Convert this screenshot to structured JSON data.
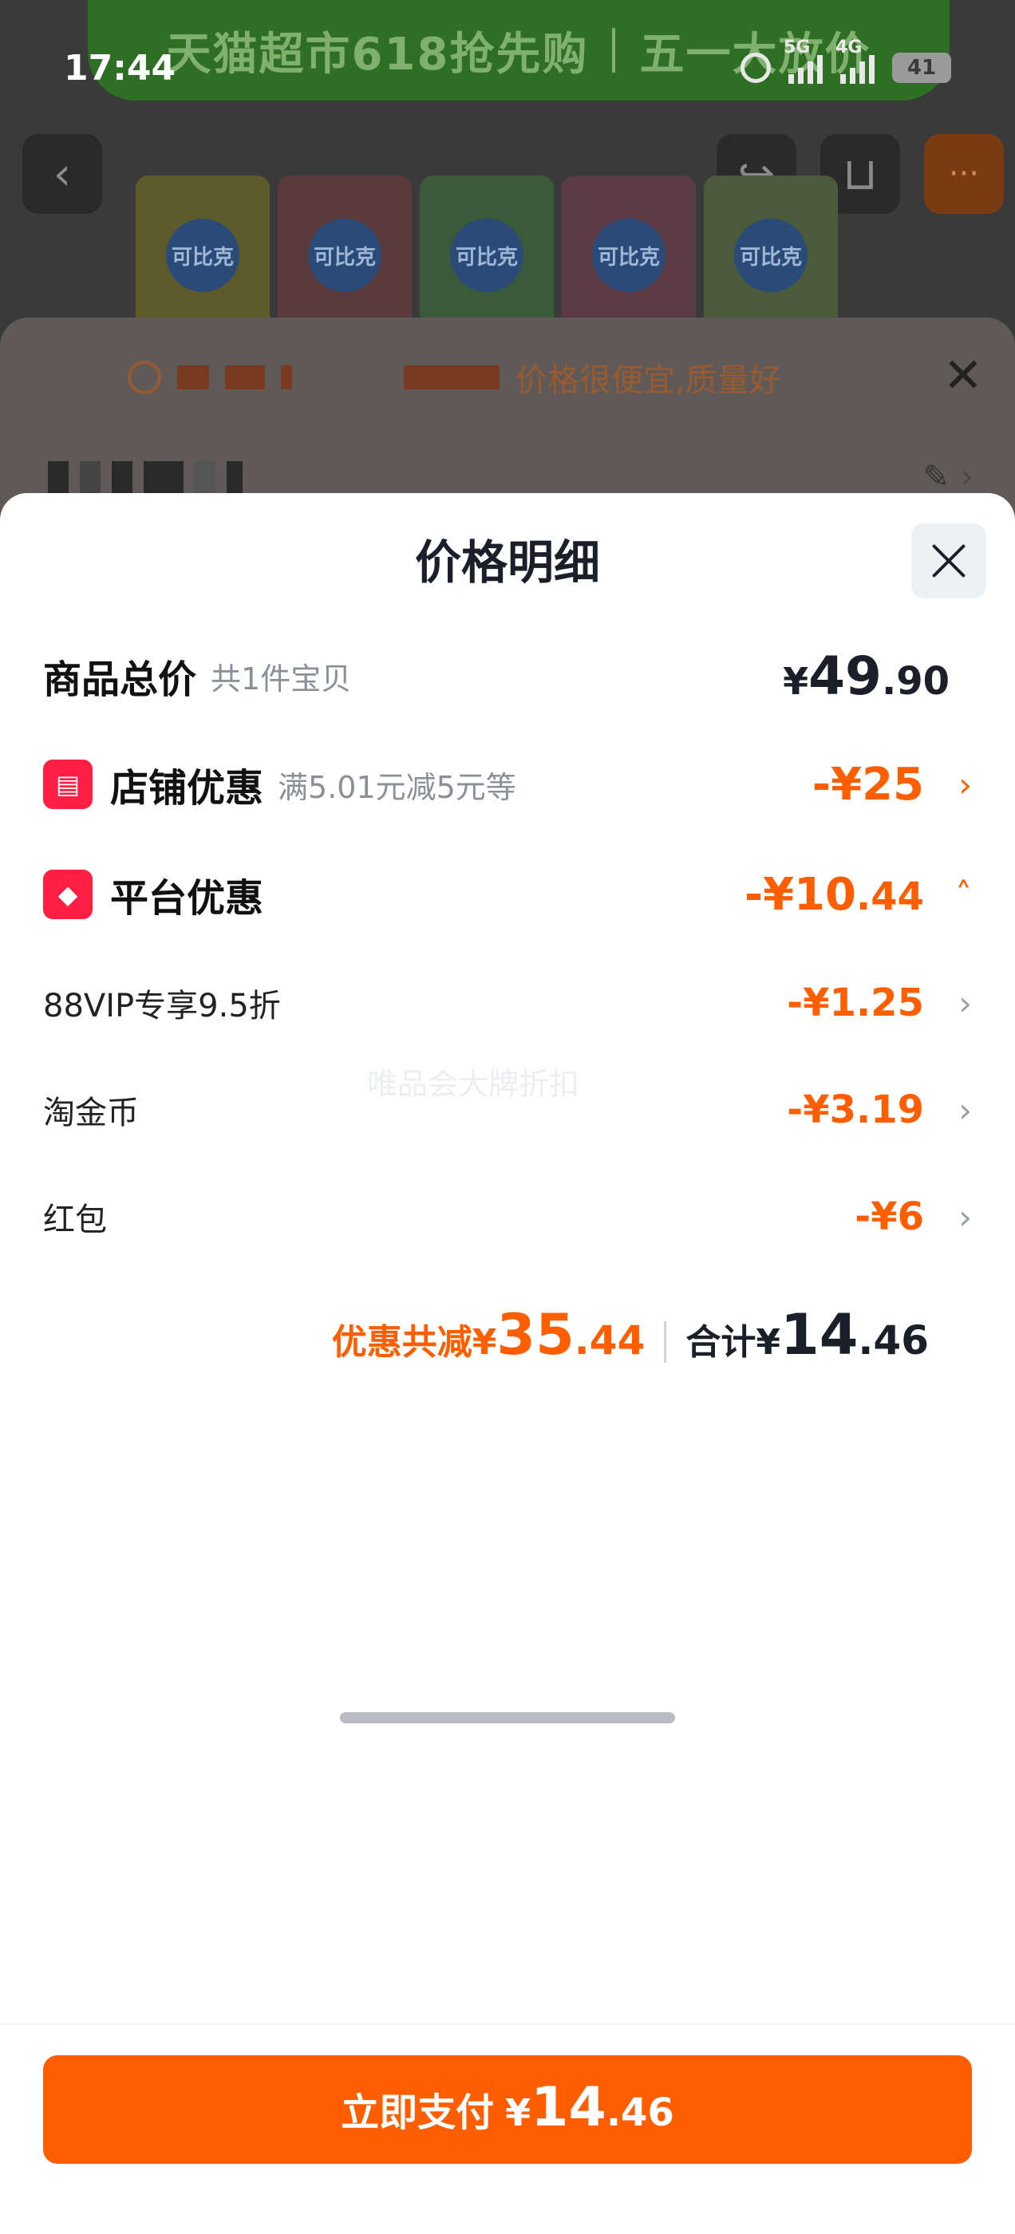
{
  "status_bar": {
    "time": "17:44",
    "net_5g": "5G",
    "net_4g": "4G",
    "battery": "41"
  },
  "promo_banner": {
    "left_text": "天猫超市618抢先购",
    "right_text": "五一大放价"
  },
  "review_banner": {
    "text": "价格很便宜,质量好"
  },
  "price_detail": {
    "title": "价格明细",
    "goods_total": {
      "label": "商品总价",
      "sub": "共1件宝贝",
      "currency": "¥",
      "int": "49",
      "dec": ".90"
    },
    "shop_discount": {
      "label": "店铺优惠",
      "sub": "满5.01元减5元等",
      "amount": "-¥25"
    },
    "platform_discount": {
      "label": "平台优惠",
      "amount_int": "-¥10",
      "amount_dec": ".44"
    },
    "items": [
      {
        "label": "88VIP专享9.5折",
        "amount": "-¥1.25"
      },
      {
        "label": "淘金币",
        "amount": "-¥3.19"
      },
      {
        "label": "红包",
        "amount": "-¥6"
      }
    ],
    "watermark": "唯品会大牌折扣",
    "summary": {
      "discount_label": "优惠共减¥",
      "discount_int": "35",
      "discount_dec": ".44",
      "total_label": "合计¥",
      "total_int": "14",
      "total_dec": ".46"
    }
  },
  "pay_button": {
    "label": "立即支付",
    "currency": "¥",
    "int": "14",
    "dec": ".46"
  },
  "colors": {
    "accent_orange": "#ff5e00",
    "badge_red": "#ff1f44",
    "title_dark": "#1b1f2a"
  },
  "icons": [
    "back-icon",
    "share-icon",
    "cart-icon",
    "more-icon",
    "chat-icon",
    "close-icon",
    "edit-icon",
    "shop-icon",
    "tag-icon",
    "chevron-right-icon",
    "chevron-up-icon"
  ]
}
